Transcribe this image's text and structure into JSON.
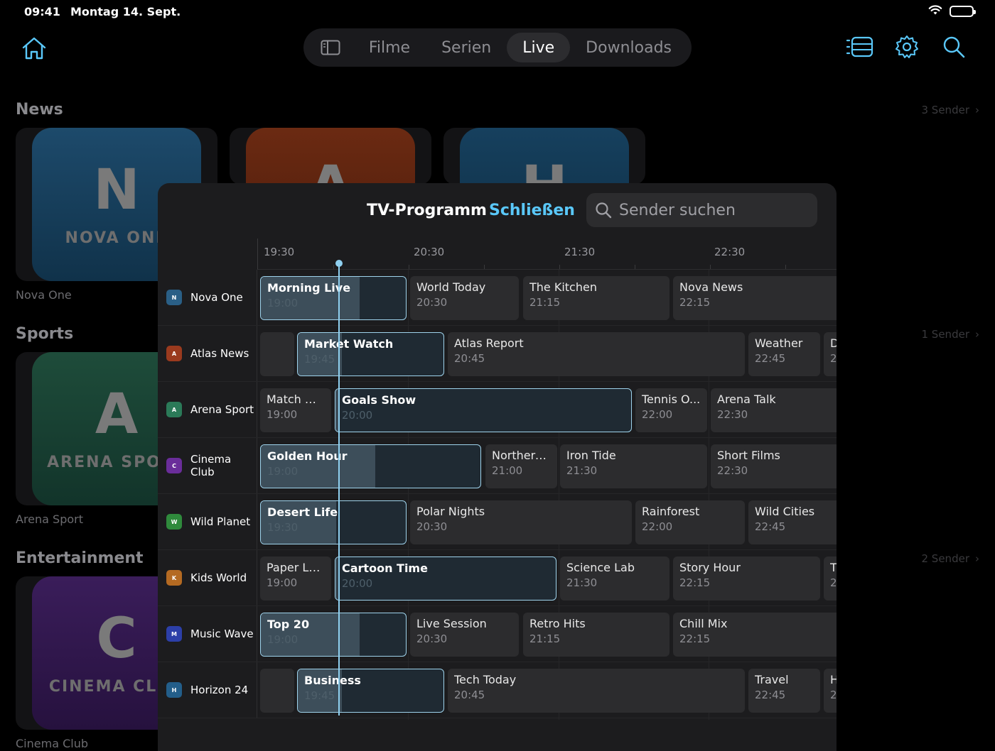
{
  "status": {
    "time": "09:41",
    "date": "Montag 14. Sept."
  },
  "nav": {
    "tabs": [
      "Filme",
      "Serien",
      "Live",
      "Downloads"
    ],
    "active": "Live"
  },
  "sections": [
    {
      "title": "News",
      "count": "3 Sender"
    },
    {
      "title": "Sports",
      "count": "1 Sender"
    },
    {
      "title": "Entertainment",
      "count": "2 Sender"
    }
  ],
  "cards": [
    {
      "letter": "N",
      "brand": "NOVA ONE",
      "label": "Nova One"
    },
    {
      "letter": "A",
      "brand": "ARENA SPORT",
      "label": "Arena Sport"
    },
    {
      "letter": "C",
      "brand": "CINEMA CLUB",
      "label": "Cinema Club"
    }
  ],
  "news_peek": [
    {
      "letter": "A"
    },
    {
      "letter": "H"
    }
  ],
  "sheet": {
    "title": "TV-Programm",
    "close": "Schließen",
    "search_placeholder": "Sender suchen"
  },
  "timeline": [
    "19:30",
    "20:30",
    "21:30",
    "22:30"
  ],
  "channels": [
    {
      "name": "Nova One",
      "logo": "N",
      "color": "#2a5f86",
      "programs": [
        {
          "title": "",
          "time": ""
        },
        {
          "title": "Morning Live",
          "time": "19:00",
          "live": true,
          "progress": 0.68
        },
        {
          "title": "World Today",
          "time": "20:30"
        },
        {
          "title": "The Kitchen",
          "time": "21:15"
        },
        {
          "title": "Nova News",
          "time": "22:15"
        }
      ]
    },
    {
      "name": "Atlas News",
      "logo": "A",
      "color": "#9a3a1e",
      "programs": [
        {
          "title": "",
          "time": ""
        },
        {
          "title": "Market Watch",
          "time": "19:45",
          "live": true,
          "progress": 0.3
        },
        {
          "title": "Atlas Report",
          "time": "20:45"
        },
        {
          "title": "Weather",
          "time": "22:45"
        },
        {
          "title": "D",
          "time": "2"
        }
      ]
    },
    {
      "name": "Arena Sport",
      "logo": "A",
      "color": "#2b7a58",
      "programs": [
        {
          "title": "Match Day",
          "time": "19:00"
        },
        {
          "title": "Goals Show",
          "time": "20:00",
          "live": true,
          "progress": 0.01
        },
        {
          "title": "Tennis O...",
          "time": "22:00"
        },
        {
          "title": "Arena Talk",
          "time": "22:30"
        }
      ]
    },
    {
      "name": "Cinema Club",
      "logo": "C",
      "color": "#6a2d9a",
      "programs": [
        {
          "title": "Golden Hour",
          "time": "19:00",
          "live": true,
          "progress": 0.52
        },
        {
          "title": "Northern...",
          "time": "21:00"
        },
        {
          "title": "Iron Tide",
          "time": "21:30"
        },
        {
          "title": "Short Films",
          "time": "22:30"
        }
      ]
    },
    {
      "name": "Wild Planet",
      "logo": "W",
      "color": "#2f8a3c",
      "programs": [
        {
          "title": "Desert Life",
          "time": "19:30",
          "live": true,
          "progress": 0.52
        },
        {
          "title": "Polar Nights",
          "time": "20:30"
        },
        {
          "title": "Rainforest",
          "time": "22:00"
        },
        {
          "title": "Wild Cities",
          "time": "22:45"
        }
      ]
    },
    {
      "name": "Kids World",
      "logo": "K",
      "color": "#b46a22",
      "programs": [
        {
          "title": "Paper La...",
          "time": "19:00"
        },
        {
          "title": "Cartoon Time",
          "time": "20:00",
          "live": true,
          "progress": 0.01
        },
        {
          "title": "Science Lab",
          "time": "21:30"
        },
        {
          "title": "Story Hour",
          "time": "22:15"
        },
        {
          "title": "T",
          "time": "2"
        }
      ]
    },
    {
      "name": "Music Wave",
      "logo": "M",
      "color": "#2c3fa8",
      "programs": [
        {
          "title": "Top 20",
          "time": "19:00",
          "live": true,
          "progress": 0.68
        },
        {
          "title": "Live Session",
          "time": "20:30"
        },
        {
          "title": "Retro Hits",
          "time": "21:15"
        },
        {
          "title": "Chill Mix",
          "time": "22:15"
        }
      ]
    },
    {
      "name": "Horizon 24",
      "logo": "H",
      "color": "#235e8a",
      "programs": [
        {
          "title": "",
          "time": ""
        },
        {
          "title": "Business",
          "time": "19:45",
          "live": true,
          "progress": 0.3
        },
        {
          "title": "Tech Today",
          "time": "20:45"
        },
        {
          "title": "Travel",
          "time": "22:45"
        },
        {
          "title": "H",
          "time": "2"
        }
      ]
    }
  ],
  "colors": {
    "accent": "#5ac8fa",
    "now": "#8fd0f0"
  }
}
